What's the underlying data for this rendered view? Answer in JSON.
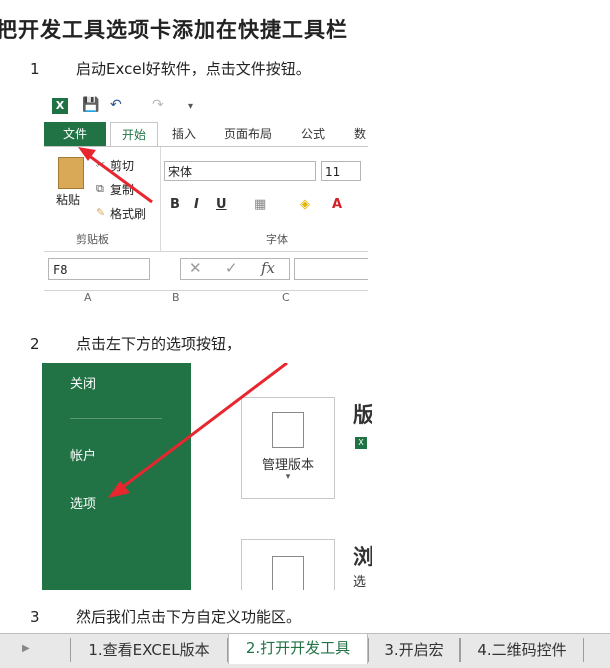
{
  "title": "把开发工具选项卡添加在快捷工具栏",
  "steps": [
    {
      "num": "1",
      "text": "启动Excel好软件，点击文件按钮。"
    },
    {
      "num": "2",
      "text": "点击左下方的选项按钮，"
    },
    {
      "num": "3",
      "text": "然后我们点击下方自定义功能区。"
    }
  ],
  "excel": {
    "logo": "X",
    "tabs": [
      "文件",
      "开始",
      "插入",
      "页面布局",
      "公式",
      "数"
    ],
    "clipboard": {
      "paste": "粘贴",
      "cut": "剪切",
      "copy": "复制",
      "format_painter": "格式刷",
      "group": "剪贴板"
    },
    "font": {
      "name": "宋体",
      "size": "11",
      "group": "字体",
      "bold": "B",
      "italic": "I",
      "underline": "U",
      "color_a": "A"
    },
    "name_box": "F8",
    "fx": "fx",
    "col_letters": [
      "A",
      "B",
      "C"
    ]
  },
  "backstage": {
    "items": [
      "关闭",
      "帐户",
      "选项"
    ],
    "card1_label": "管理版本",
    "side1": "版",
    "side2": "浏",
    "side2_sub": "选",
    "arrow_color": "#e8262f"
  },
  "sheet_tabs": [
    {
      "label": "1.查看EXCEL版本",
      "active": false
    },
    {
      "label": "2.打开开发工具",
      "active": true
    },
    {
      "label": "3.开启宏",
      "active": false
    },
    {
      "label": "4.二维码控件",
      "active": false
    }
  ]
}
